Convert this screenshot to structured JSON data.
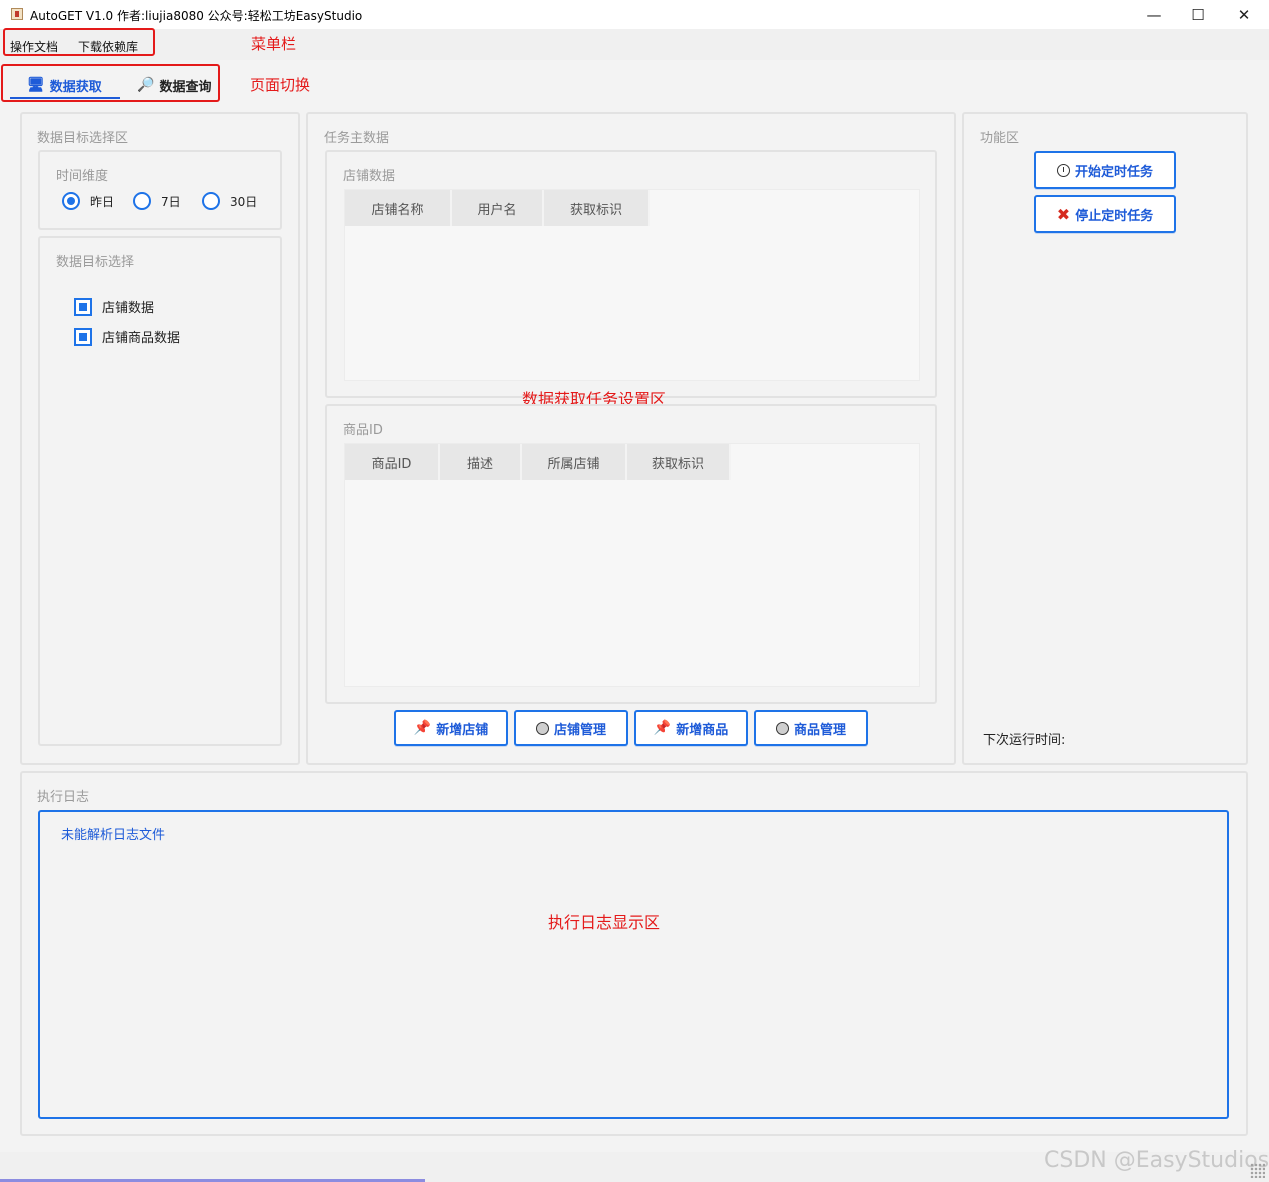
{
  "window": {
    "title": "AutoGET V1.0 作者:liujia8080 公众号:轻松工坊EasyStudio",
    "minimize": "—",
    "maximize": "☐",
    "close": "✕"
  },
  "menu": {
    "items": [
      "操作文档",
      "下载依赖库"
    ]
  },
  "annotations": {
    "menubar": "菜单栏",
    "page_switch": "页面切换",
    "task_area": "数据获取任务设置区",
    "log_area": "执行日志显示区"
  },
  "tabs": [
    {
      "label": "数据获取",
      "icon": "monitor-icon",
      "active": true
    },
    {
      "label": "数据查询",
      "icon": "magnifier-icon",
      "active": false
    }
  ],
  "target_panel": {
    "title": "数据目标选择区",
    "time_group": {
      "title": "时间维度",
      "options": [
        "昨日",
        "7日",
        "30日"
      ],
      "selected": "昨日"
    },
    "target_group": {
      "title": "数据目标选择",
      "options": [
        {
          "label": "店铺数据",
          "checked": true
        },
        {
          "label": "店铺商品数据",
          "checked": true
        }
      ]
    }
  },
  "task_panel": {
    "title": "任务主数据",
    "shop_group": {
      "title": "店铺数据",
      "columns": [
        "店铺名称",
        "用户名",
        "获取标识"
      ]
    },
    "product_group": {
      "title": "商品ID",
      "columns": [
        "商品ID",
        "描述",
        "所属店铺",
        "获取标识"
      ]
    },
    "buttons": [
      {
        "label": "新增店铺",
        "icon": "pushpin-icon"
      },
      {
        "label": "店铺管理",
        "icon": "circle-icon"
      },
      {
        "label": "新增商品",
        "icon": "pushpin-icon"
      },
      {
        "label": "商品管理",
        "icon": "circle-icon"
      }
    ]
  },
  "function_panel": {
    "title": "功能区",
    "start_label": "开始定时任务",
    "stop_label": "停止定时任务",
    "next_run_label": "下次运行时间:"
  },
  "log_panel": {
    "title": "执行日志",
    "content": "未能解析日志文件"
  },
  "watermark": "CSDN @EasyStudios"
}
